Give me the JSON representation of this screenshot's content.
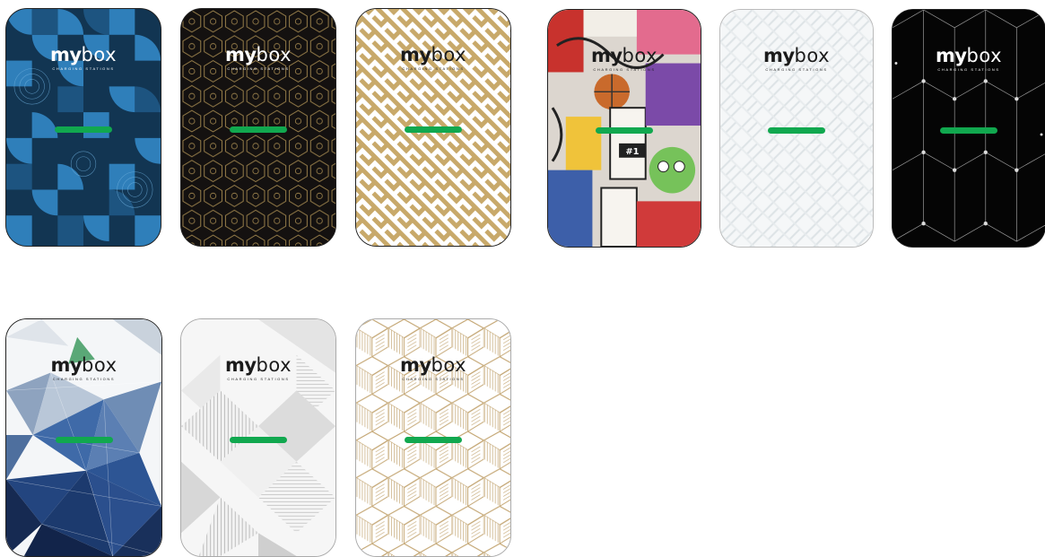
{
  "brand": {
    "name_part1": "my",
    "name_part2": "box",
    "tagline": "CHARGING STATIONS"
  },
  "colors": {
    "led_green": "#11a84f",
    "outline": "#222222"
  },
  "designs": [
    {
      "pattern": "blue-geometric-quarter-circles",
      "theme": "dark"
    },
    {
      "pattern": "black-gold-hexagons",
      "theme": "dark"
    },
    {
      "pattern": "gold-maze-stripes",
      "theme": "light"
    },
    {
      "pattern": "sticker-bomb-college",
      "theme": "light"
    },
    {
      "pattern": "light-grey-chevron",
      "theme": "light"
    },
    {
      "pattern": "black-cube-network",
      "theme": "dark"
    },
    {
      "pattern": "blue-low-poly",
      "theme": "light"
    },
    {
      "pattern": "grey-diamond-prism",
      "theme": "light"
    },
    {
      "pattern": "gold-cube-stripes",
      "theme": "light"
    }
  ]
}
